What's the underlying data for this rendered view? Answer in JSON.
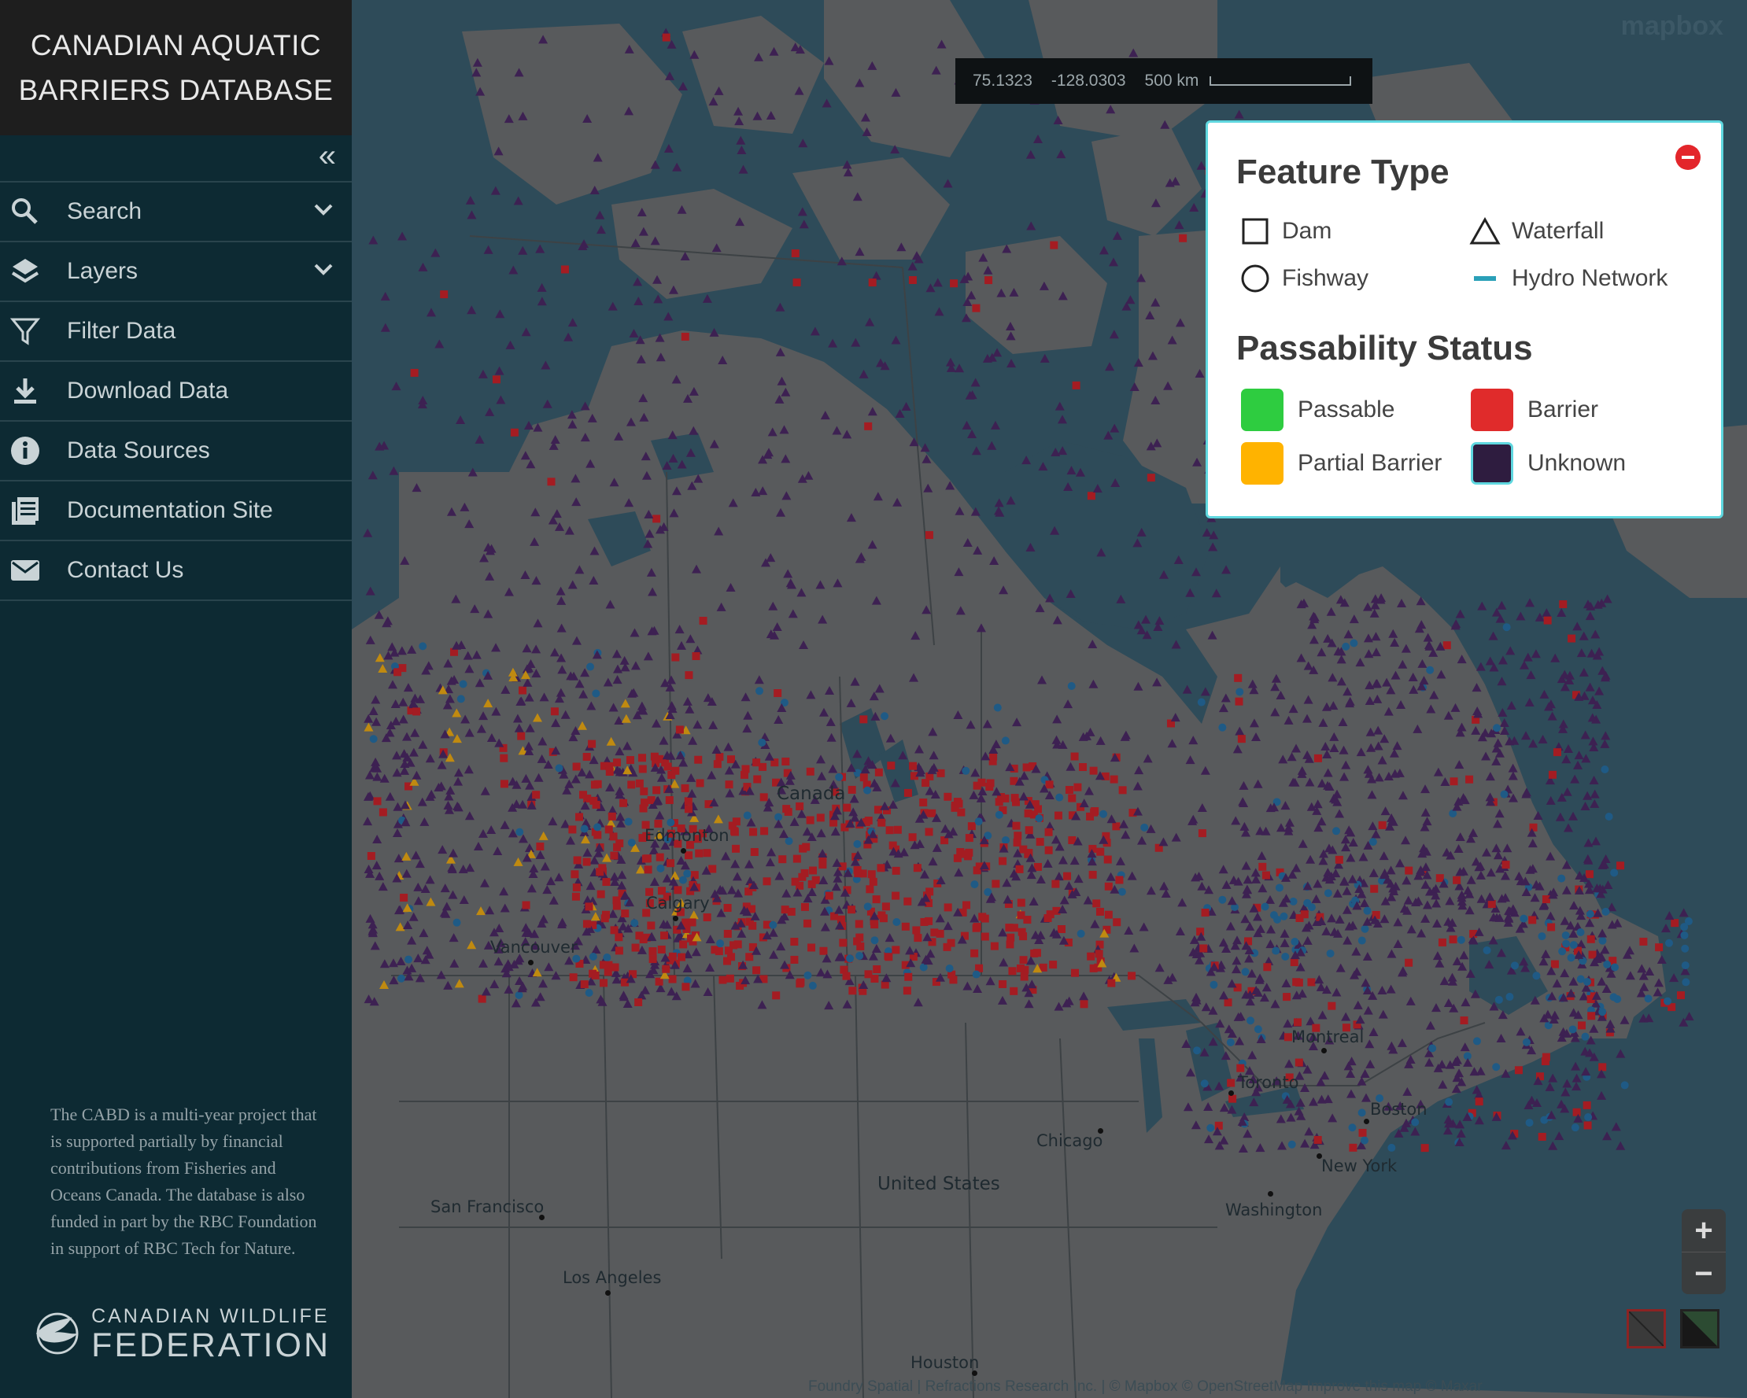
{
  "app": {
    "title_line1": "CANADIAN AQUATIC",
    "title_line2": "BARRIERS DATABASE",
    "collapse_icon": "double-chevron-left-icon"
  },
  "sidebar": {
    "items": [
      {
        "label": "Search",
        "icon": "search-icon",
        "expandable": true
      },
      {
        "label": "Layers",
        "icon": "layers-icon",
        "expandable": true
      },
      {
        "label": "Filter Data",
        "icon": "filter-icon",
        "expandable": false
      },
      {
        "label": "Download Data",
        "icon": "download-icon",
        "expandable": false
      },
      {
        "label": "Data Sources",
        "icon": "info-icon",
        "expandable": false
      },
      {
        "label": "Documentation Site",
        "icon": "document-icon",
        "expandable": false
      },
      {
        "label": "Contact Us",
        "icon": "mail-icon",
        "expandable": false
      }
    ],
    "footer_text": "The CABD is a multi-year project that is supported partially by financial contributions from Fisheries and Oceans Canada. The database is also funded in part by the RBC Foundation in support of RBC Tech for Nature.",
    "logo": {
      "line1": "CANADIAN WILDLIFE",
      "line2": "FEDERATION"
    }
  },
  "map": {
    "scale": {
      "lat": "75.1323",
      "lon": "-128.0303",
      "distance": "500 km"
    },
    "mapbox_logo": "mapbox",
    "place_labels": {
      "canada": "Canada",
      "edmonton": "Edmonton",
      "calgary": "Calgary",
      "vancouver": "Vancouver",
      "montreal": "Montreal",
      "toronto": "Toronto",
      "boston": "Boston",
      "new_york": "New York",
      "washington": "Washington",
      "chicago": "Chicago",
      "united_states": "United States",
      "san_francisco": "San Francisco",
      "los_angeles": "Los Angeles",
      "houston": "Houston"
    },
    "attribution": "Foundry Spatial  |  Refractions Research Inc.  |  © Mapbox  © OpenStreetMap  Improve this map  © Maxar",
    "controls": {
      "zoom_in": "+",
      "zoom_out": "−"
    }
  },
  "legend": {
    "feature_title": "Feature Type",
    "features": {
      "dam": "Dam",
      "waterfall": "Waterfall",
      "fishway": "Fishway",
      "hydro": "Hydro Network"
    },
    "status_title": "Passability Status",
    "statuses": {
      "passable": {
        "label": "Passable",
        "color": "#2ecc40"
      },
      "barrier": {
        "label": "Barrier",
        "color": "#e02b2b"
      },
      "partial": {
        "label": "Partial Barrier",
        "color": "#ffb300"
      },
      "unknown": {
        "label": "Unknown",
        "color": "#2e1c3f"
      }
    },
    "hydro_color": "#2aa0b8",
    "close_icon": "minus-circle-icon"
  }
}
